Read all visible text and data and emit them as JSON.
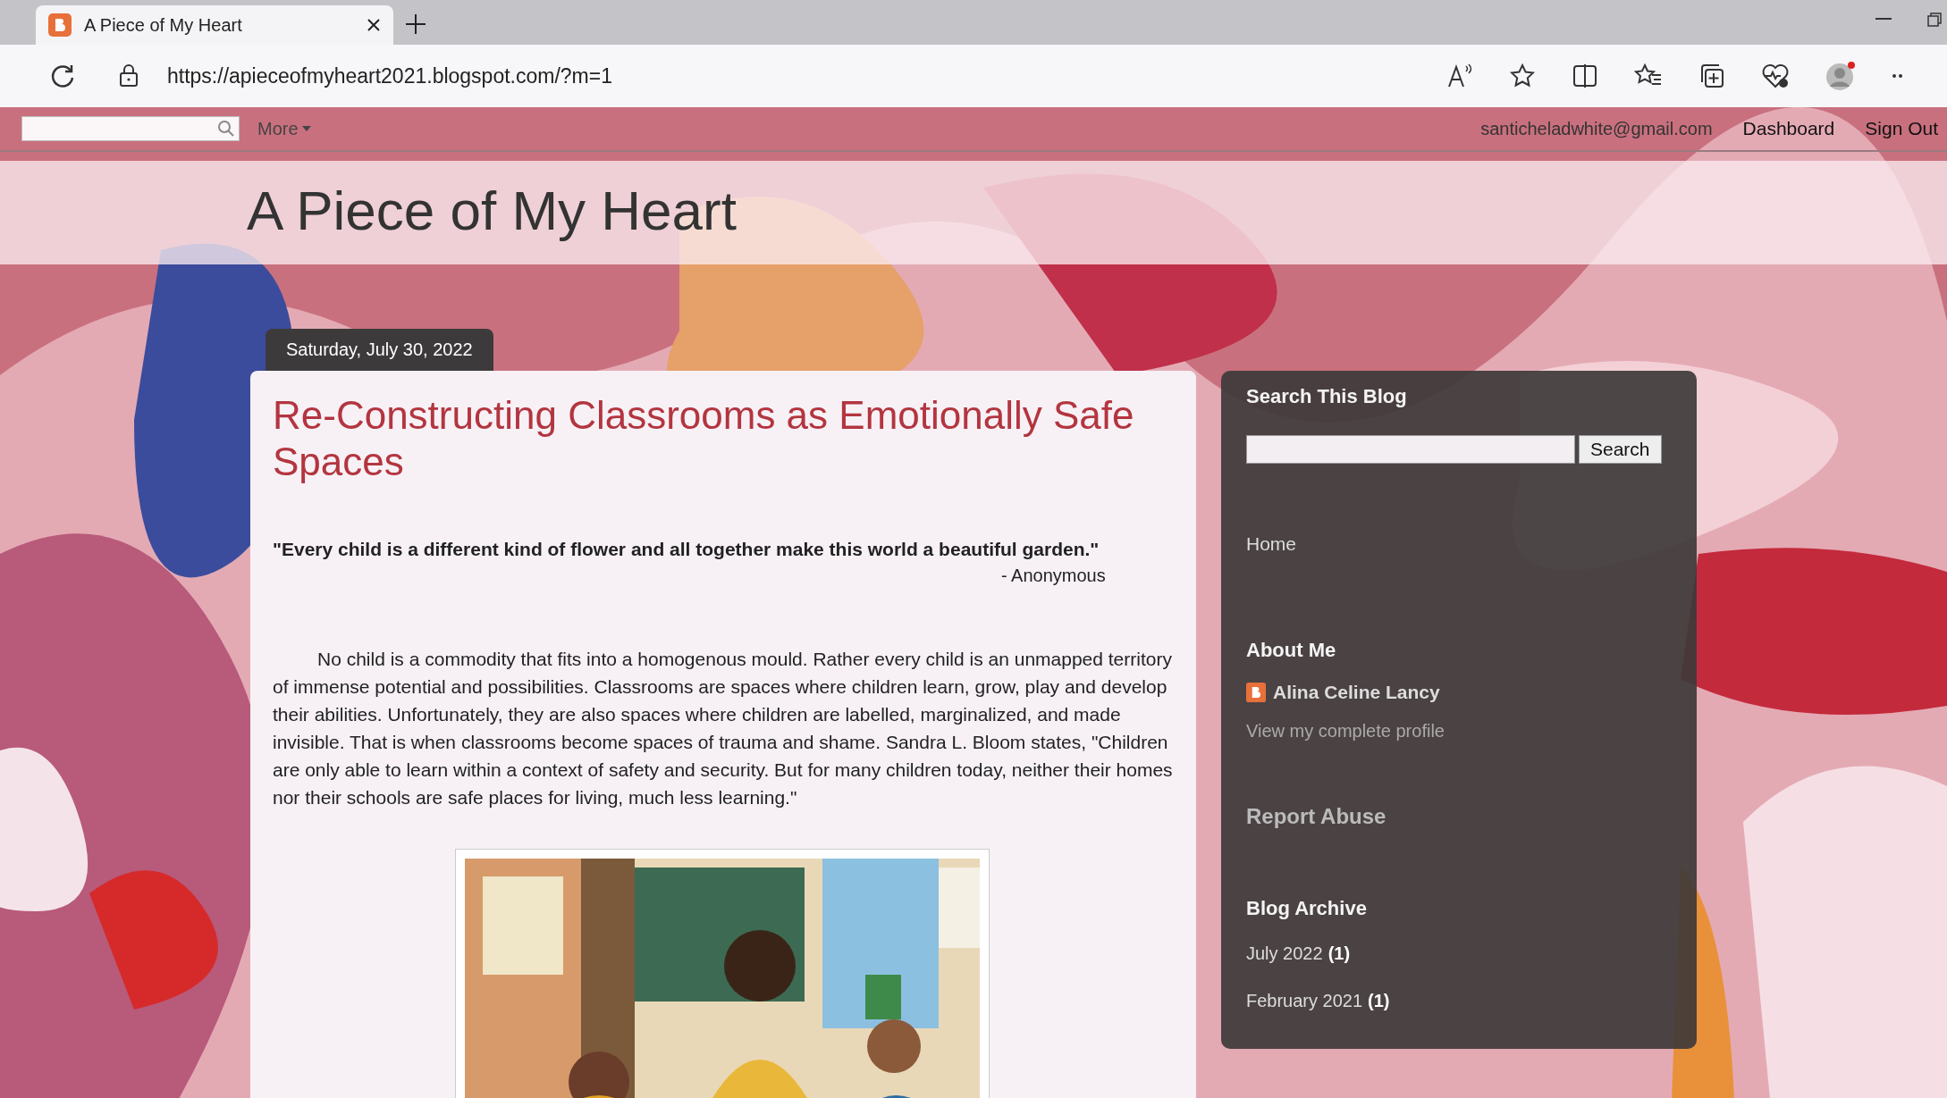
{
  "browser": {
    "tabs": [
      {
        "title": "A Piece of My Heart",
        "selected": true
      }
    ],
    "url": "https://apieceofmyheart2021.blogspot.com/?m=1"
  },
  "navbar": {
    "more": "More",
    "email": "santicheladwhite@gmail.com",
    "links": [
      "Dashboard",
      "Sign Out"
    ]
  },
  "blog": {
    "title": "A Piece of My Heart"
  },
  "post": {
    "date": "Saturday, July 30, 2022",
    "title": "Re-Constructing Classrooms as Emotionally Safe Spaces",
    "quote": "\"Every child is a different kind of flower and all together make this world a beautiful garden.\"",
    "quote_author": "- Anonymous",
    "body": "No child is a commodity that fits into a homogenous mould. Rather every child is an unmapped territory of immense potential and possibilities. Classrooms are spaces where children learn, grow, play and develop their abilities. Unfortunately, they are also spaces where children are labelled, marginalized, and made invisible. That is when classrooms become spaces of trauma and shame. Sandra L. Bloom states, \"Children are only able to learn within a context of safety and security. But for many children today, neither their homes nor their schools are safe places for living, much less learning.\""
  },
  "sidebar": {
    "search": {
      "heading": "Search This Blog",
      "button": "Search"
    },
    "pages": [
      "Home"
    ],
    "about": {
      "heading": "About Me",
      "name": "Alina Celine Lancy",
      "profile_link": "View my complete profile"
    },
    "report": "Report Abuse",
    "archive": {
      "heading": "Blog Archive",
      "items": [
        {
          "month": "July 2022",
          "count": "(1)"
        },
        {
          "month": "February 2021",
          "count": "(1)"
        }
      ]
    }
  }
}
